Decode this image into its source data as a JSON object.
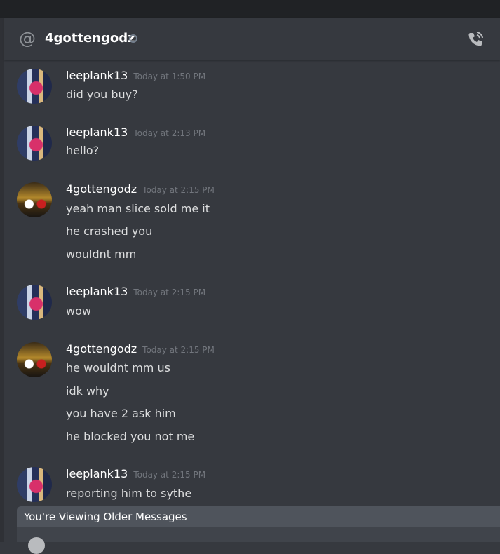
{
  "header": {
    "username": "4gottengodz",
    "at_icon": "at-icon",
    "status_icon": "status-dot-icon",
    "call_icon": "call-icon"
  },
  "messages": [
    {
      "author": "leeplank13",
      "timestamp": "Today at 1:50 PM",
      "lines": [
        "did you buy?"
      ]
    },
    {
      "author": "leeplank13",
      "timestamp": "Today at 2:13 PM",
      "lines": [
        "hello?"
      ]
    },
    {
      "author": "4gottengodz",
      "timestamp": "Today at 2:15 PM",
      "lines": [
        "yeah man slice sold me it",
        "he crashed you",
        "wouldnt mm"
      ]
    },
    {
      "author": "leeplank13",
      "timestamp": "Today at 2:15 PM",
      "lines": [
        "wow"
      ]
    },
    {
      "author": "4gottengodz",
      "timestamp": "Today at 2:15 PM",
      "lines": [
        "he wouldnt mm us",
        "idk why",
        "you have 2 ask him",
        "he blocked you not me"
      ]
    },
    {
      "author": "leeplank13",
      "timestamp": "Today at 2:15 PM",
      "lines": [
        "reporting him to sythe"
      ]
    }
  ],
  "older_messages_bar": {
    "label": "You're Viewing Older Messages"
  }
}
